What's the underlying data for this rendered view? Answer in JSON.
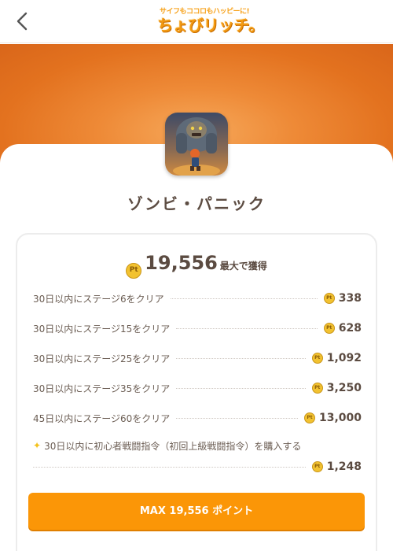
{
  "header": {
    "logo_tagline": "サイフもココロもハッピーに!",
    "logo_main": "ちょびリッチ。"
  },
  "app": {
    "title": "ゾンビ・パニック",
    "icon": "zombie-panic-app-icon"
  },
  "points": {
    "coin_symbol": "Pt",
    "total_value": "19,556",
    "total_suffix": "最大で獲得",
    "rows": [
      {
        "label": "30日以内にステージ6をクリア",
        "value": "338"
      },
      {
        "label": "30日以内にステージ15をクリア",
        "value": "628"
      },
      {
        "label": "30日以内にステージ25をクリア",
        "value": "1,092"
      },
      {
        "label": "30日以内にステージ35をクリア",
        "value": "3,250"
      },
      {
        "label": "45日以内にステージ60をクリア",
        "value": "13,000"
      }
    ],
    "special": {
      "label": "30日以内に初心者戦闘指令（初回上級戦闘指令）を購入する",
      "value": "1,248"
    }
  },
  "cta": {
    "label": "MAX 19,556 ポイント"
  },
  "colors": {
    "accent": "#fb9607",
    "banner": "#e77a27",
    "coin": "#f2c230"
  }
}
